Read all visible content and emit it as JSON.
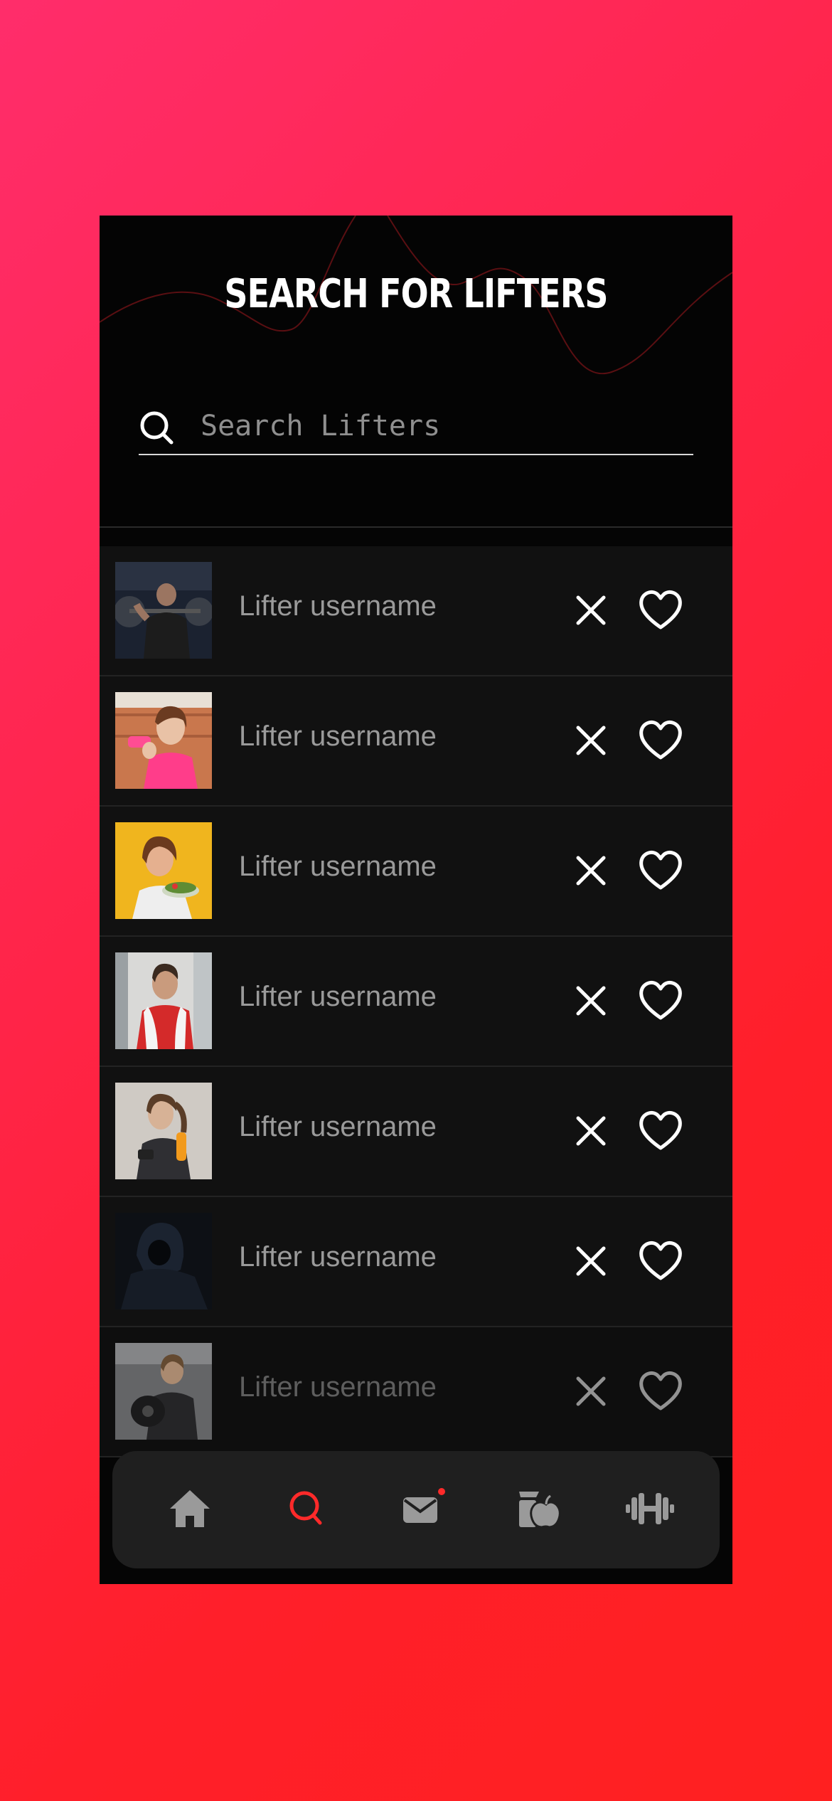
{
  "header": {
    "title": "SEARCH FOR LIFTERS"
  },
  "search": {
    "placeholder": "Search Lifters",
    "value": "",
    "icon": "search-icon"
  },
  "lifters": [
    {
      "username": "Lifter username",
      "photo": "man-gym-weights"
    },
    {
      "username": "Lifter username",
      "photo": "woman-pink-dumbbell"
    },
    {
      "username": "Lifter username",
      "photo": "woman-eating-salad"
    },
    {
      "username": "Lifter username",
      "photo": "man-towel-gym"
    },
    {
      "username": "Lifter username",
      "photo": "woman-water-bottle"
    },
    {
      "username": "Lifter username",
      "photo": "hooded-figure"
    },
    {
      "username": "Lifter username",
      "photo": "woman-lifting-plate"
    }
  ],
  "actions": {
    "dismiss_icon": "close-icon",
    "like_icon": "heart-icon"
  },
  "nav": {
    "items": [
      {
        "icon": "home-icon",
        "active": false
      },
      {
        "icon": "search-icon",
        "active": true
      },
      {
        "icon": "mail-icon",
        "active": false,
        "badge": true
      },
      {
        "icon": "nutrition-icon",
        "active": false
      },
      {
        "icon": "dumbbell-icon",
        "active": false
      }
    ]
  },
  "colors": {
    "accent": "#ff2a2a",
    "background": "#050505",
    "row": "#111111",
    "nav": "#1f1f1f",
    "muted_text": "#9a9a9a",
    "nav_icon": "#9a9a9a"
  }
}
